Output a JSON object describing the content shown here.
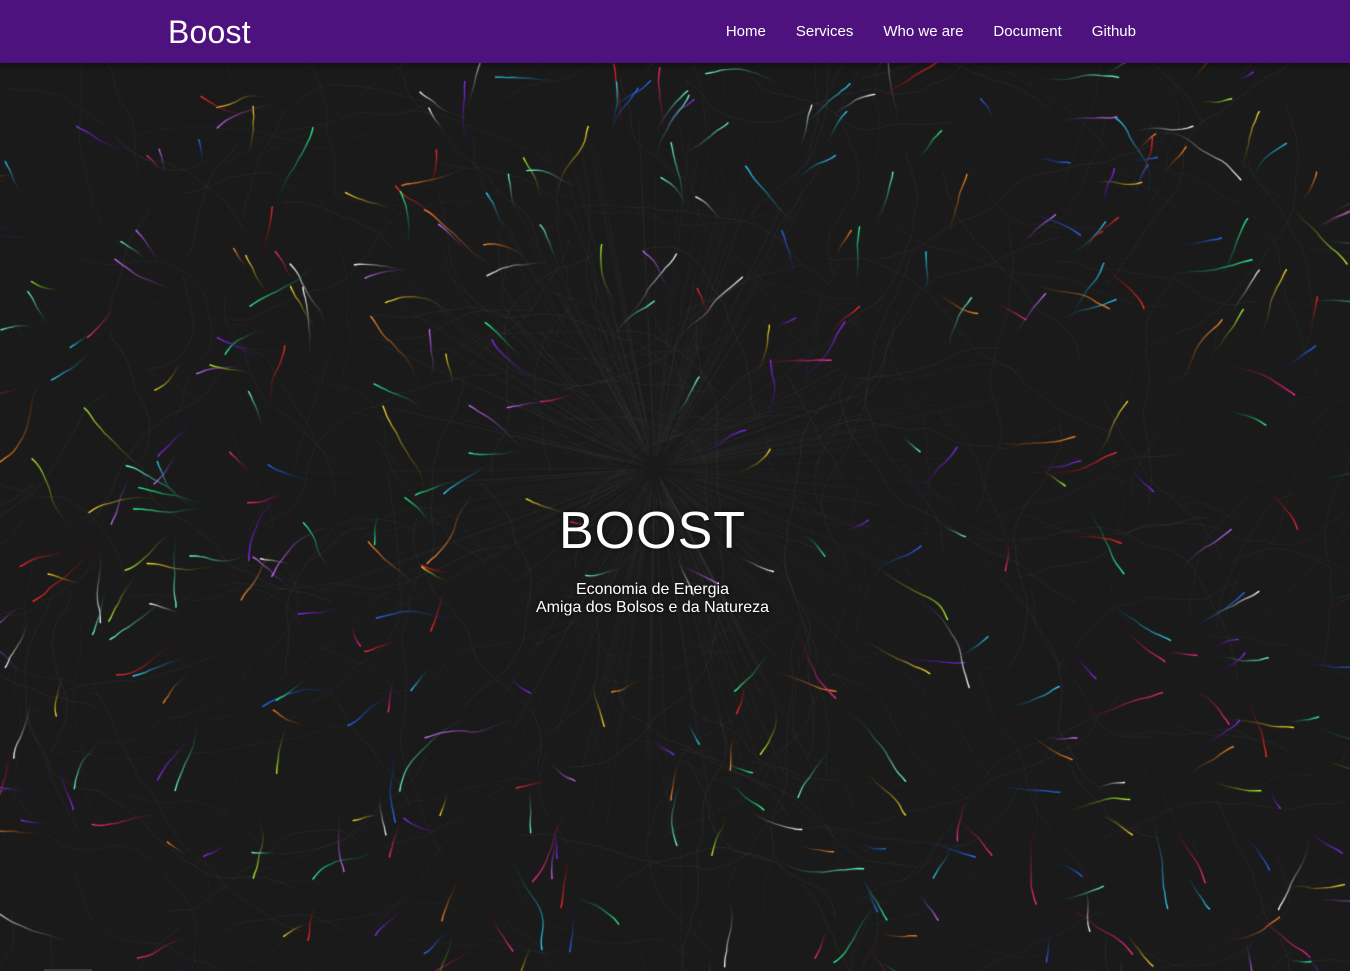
{
  "navbar": {
    "brand": "Boost",
    "links": [
      {
        "label": "Home"
      },
      {
        "label": "Services"
      },
      {
        "label": "Who we are"
      },
      {
        "label": "Document"
      },
      {
        "label": "Github"
      }
    ],
    "color": "#4d127d"
  },
  "hero": {
    "title": "BOOST",
    "subtitle_line1": "Economia de Energia",
    "subtitle_line2": "Amiga dos Bolsos e da Natureza",
    "background_color": "#1a1a1a",
    "strand_colors": [
      "#ff2a8a",
      "#2ad4ff",
      "#b6ff2a",
      "#ffffff",
      "#ff8a2a",
      "#8a2aff",
      "#2aff9a",
      "#ffe12a",
      "#ff2a2a",
      "#2a6bff",
      "#c86bff",
      "#6bffd9"
    ]
  }
}
